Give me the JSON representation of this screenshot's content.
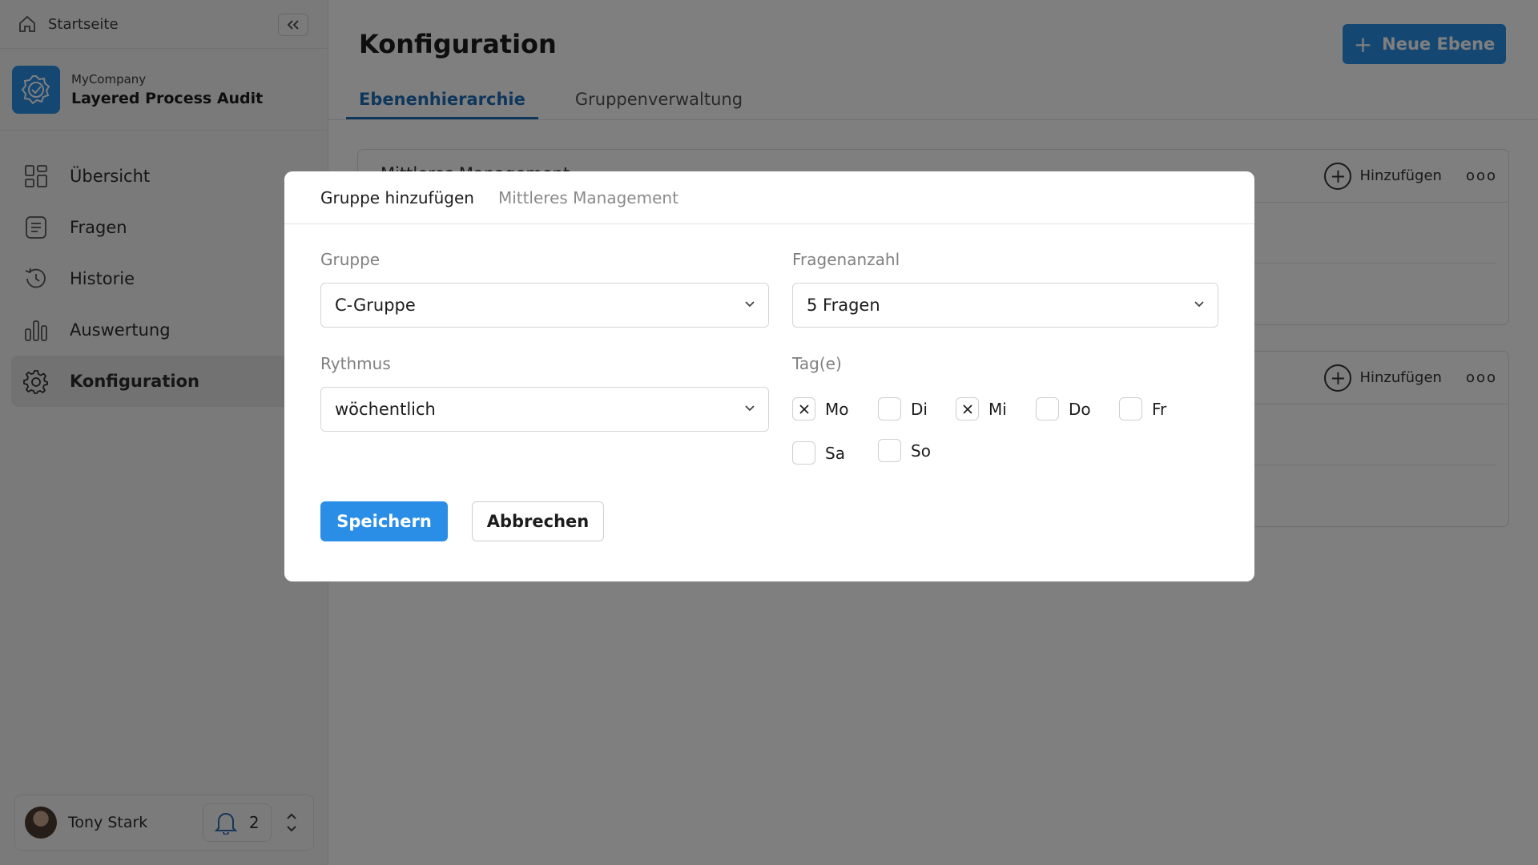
{
  "sidebar": {
    "home_label": "Startseite",
    "company_small": "MyCompany",
    "company_name": "Layered Process Audit",
    "items": [
      {
        "label": "Übersicht",
        "icon": "grid-icon"
      },
      {
        "label": "Fragen",
        "icon": "list-icon"
      },
      {
        "label": "Historie",
        "icon": "history-icon"
      },
      {
        "label": "Auswertung",
        "icon": "chart-icon"
      },
      {
        "label": "Konfiguration",
        "icon": "gear-icon",
        "active": true
      }
    ],
    "user_name": "Tony Stark",
    "notification_count": "2"
  },
  "main": {
    "title": "Konfiguration",
    "new_button": "Neue Ebene",
    "tabs": [
      "Ebenenhierarchie",
      "Gruppenverwaltung"
    ],
    "active_tab": 0,
    "card_title": "Mittleres Management",
    "add_label": "Hinzufügen",
    "more_label": "ooo"
  },
  "modal": {
    "title": "Gruppe hinzufügen",
    "subtitle": "Mittleres Management",
    "group_label": "Gruppe",
    "group_value": "C-Gruppe",
    "count_label": "Fragenanzahl",
    "count_value": "5 Fragen",
    "rhythm_label": "Rythmus",
    "rhythm_value": "wöchentlich",
    "days_label": "Tag(e)",
    "days": [
      {
        "label": "Mo",
        "checked": true
      },
      {
        "label": "Di",
        "checked": false
      },
      {
        "label": "Mi",
        "checked": true
      },
      {
        "label": "Do",
        "checked": false
      },
      {
        "label": "Fr",
        "checked": false
      },
      {
        "label": "Sa",
        "checked": false
      },
      {
        "label": "So",
        "checked": false
      }
    ],
    "save_label": "Speichern",
    "cancel_label": "Abbrechen"
  },
  "colors": {
    "accent": "#2a8ee6",
    "overlay": "rgba(0,0,0,0.5)"
  }
}
